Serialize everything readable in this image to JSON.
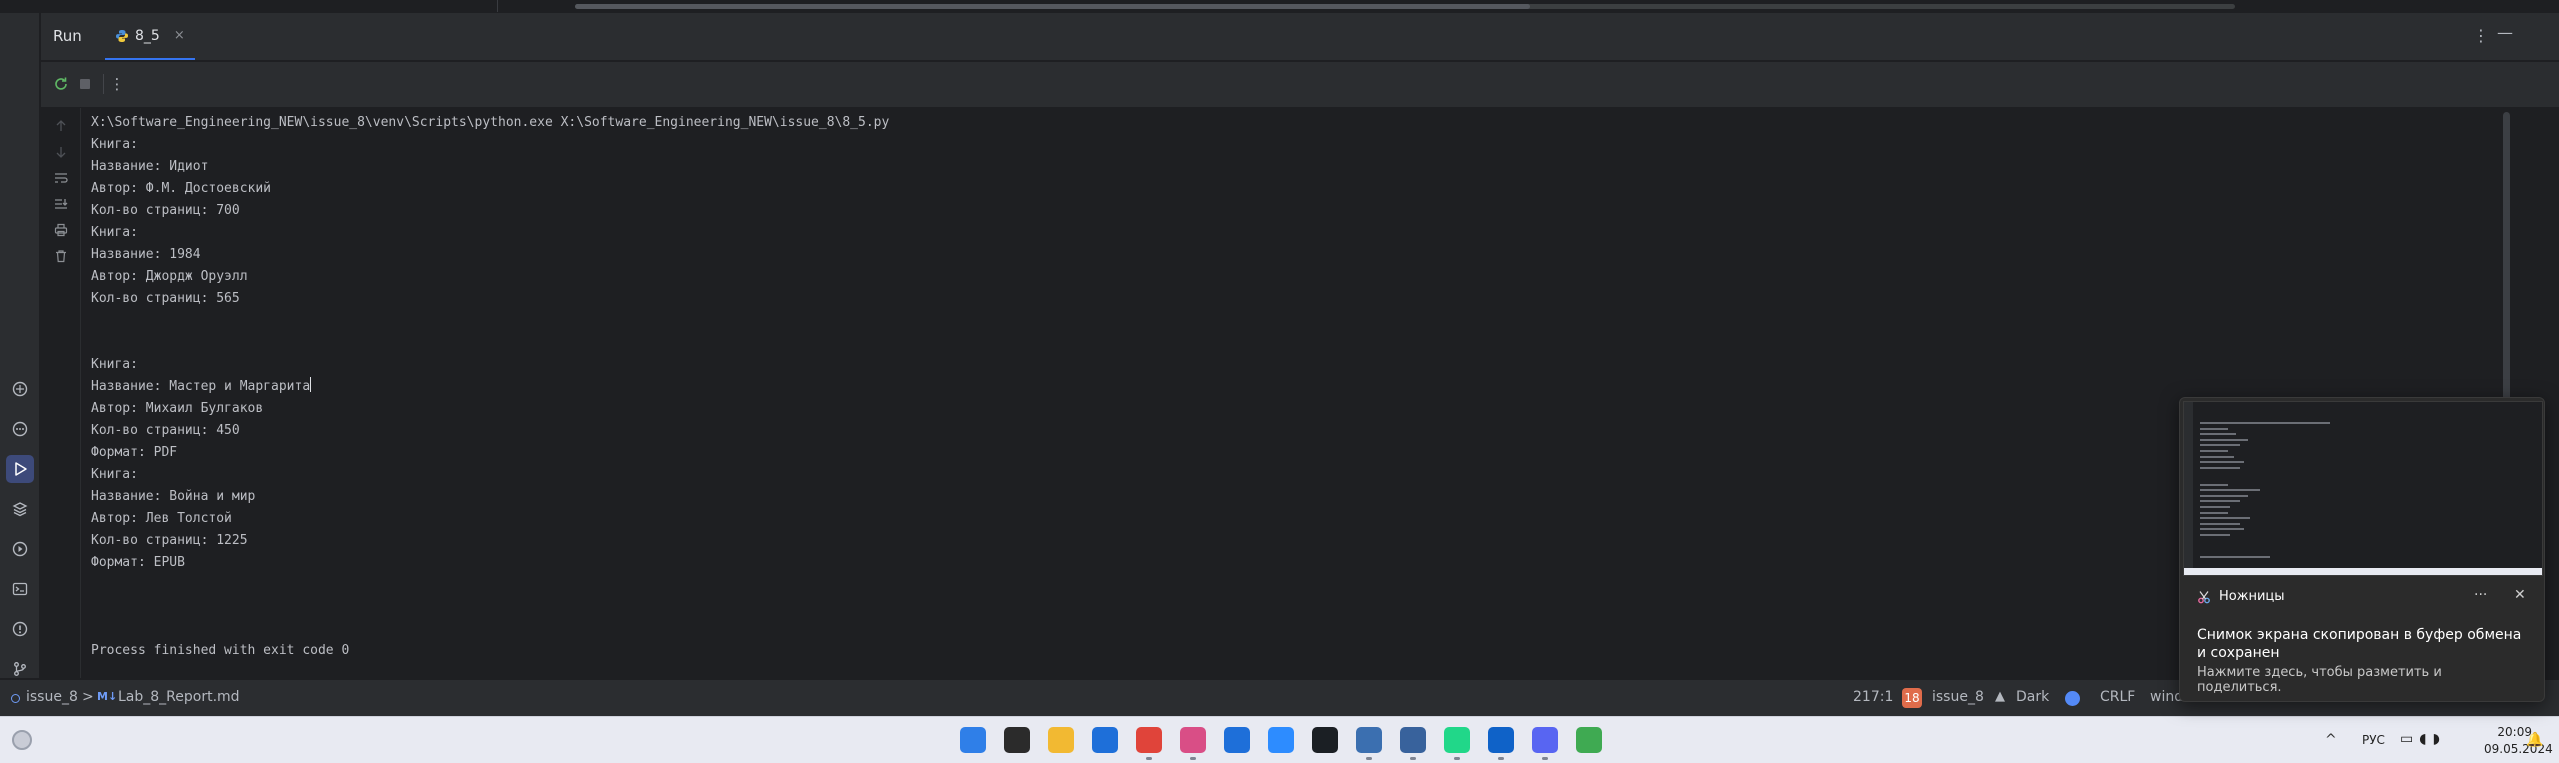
{
  "run_panel": {
    "title": "Run",
    "tab_label": "8_5",
    "tab_close": "×",
    "header_more": "⋮",
    "header_minimize": "—",
    "toolbar_more": "⋮"
  },
  "console": {
    "lines": [
      "X:\\Software_Engineering_NEW\\issue_8\\venv\\Scripts\\python.exe X:\\Software_Engineering_NEW\\issue_8\\8_5.py",
      "Книга:",
      "Название: Идиот",
      "Автор: Ф.М. Достоевский",
      "Кол-во страниц: 700",
      "Книга:",
      "Название: 1984",
      "Автор: Джордж Оруэлл",
      "Кол-во страниц: 565",
      "",
      "",
      "Книга:",
      "Название: Мастер и Маргарита",
      "Автор: Михаил Булгаков",
      "Кол-во страниц: 450",
      "Формат: PDF",
      "Книга:",
      "Название: Война и мир",
      "Автор: Лев Толстой",
      "Кол-во страниц: 1225",
      "Формат: EPUB",
      "",
      "",
      "",
      "Process finished with exit code 0"
    ]
  },
  "status_bar": {
    "project": "issue_8",
    "breadcrumb_sep": ">",
    "md_badge": "M↓",
    "file": "Lab_8_Report.md",
    "position": "217:1",
    "badge_count": "18",
    "vcs_branch": "issue_8",
    "theme": "Dark",
    "line_sep": "CRLF",
    "encoding_partial": "wind"
  },
  "taskbar": {
    "language": "РУС",
    "time": "20:09",
    "date": "09.05.2024",
    "tray_chevron": "^",
    "apps": [
      {
        "icon": "windows-start-icon",
        "color": "#2f7fe8"
      },
      {
        "icon": "terminal-icon",
        "color": "#2b2b2b"
      },
      {
        "icon": "file-explorer-icon",
        "color": "#f2b932"
      },
      {
        "icon": "mail-icon",
        "color": "#1e6fd9"
      },
      {
        "icon": "chrome-icon",
        "color": "#e0443a"
      },
      {
        "icon": "snipping-tool-icon",
        "color": "#d94e86"
      },
      {
        "icon": "store-icon",
        "color": "#1e6fd9"
      },
      {
        "icon": "zoom-icon",
        "color": "#2d8cff"
      },
      {
        "icon": "github-icon",
        "color": "#1b1f24"
      },
      {
        "icon": "python-idle-icon",
        "color": "#3b6fb0"
      },
      {
        "icon": "search-app-icon",
        "color": "#38629c"
      },
      {
        "icon": "pycharm-icon",
        "color": "#21d789"
      },
      {
        "icon": "outlook-icon",
        "color": "#0f62c8"
      },
      {
        "icon": "discord-icon",
        "color": "#5865f2"
      },
      {
        "icon": "image-viewer-icon",
        "color": "#3faa52"
      }
    ]
  },
  "toast": {
    "app_name": "Ножницы",
    "more": "···",
    "close": "✕",
    "title": "Снимок экрана скопирован в буфер обмена и сохранен",
    "body": "Нажмите здесь, чтобы разметить и поделиться."
  },
  "colors": {
    "background": "#1e1f22",
    "panel": "#2b2d30",
    "accent": "#3574f0",
    "console_text": "#bcbec4"
  }
}
